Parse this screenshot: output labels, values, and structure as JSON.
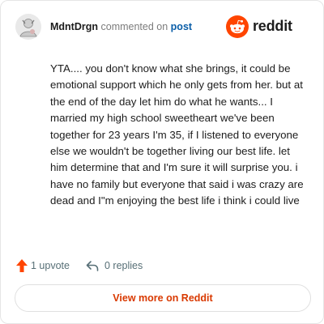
{
  "comment": {
    "author": "MdntDrgn",
    "action_text": "commented on",
    "target_link": "post",
    "body": "YTA.... you don't know what she brings, it could be emotional support which he only gets from her. but at the end of the day let him do what he wants... I married my high school sweetheart we've been together for 23 years I'm 35, if I listened to everyone else we wouldn't be together living our best life. let him determine that and I'm sure it will surprise you. i have no family but everyone that said i was crazy are dead and I\"m enjoying the best life i think i could live"
  },
  "brand": {
    "wordmark": "reddit",
    "icon": "reddit-snoo-icon",
    "color": "#ff4500"
  },
  "actions": {
    "upvote_label": "1 upvote",
    "upvote_icon": "upvote-arrow-icon",
    "upvote_color": "#ff4500",
    "reply_label": "0 replies",
    "reply_icon": "reply-icon"
  },
  "footer": {
    "view_more_label": "View more on Reddit",
    "accent": "#d93900"
  }
}
